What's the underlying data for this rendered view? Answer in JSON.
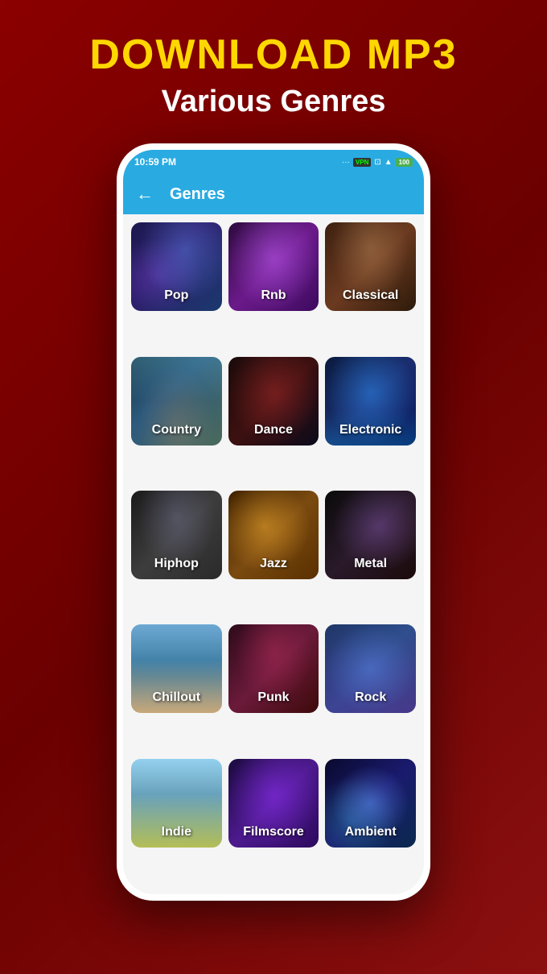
{
  "page": {
    "background": "#8B0000",
    "main_title": "DOWNLOAD MP3",
    "sub_title": "Various Genres"
  },
  "status_bar": {
    "time": "10:59 PM",
    "vpn": "VPN",
    "battery": "100"
  },
  "header": {
    "back_label": "←",
    "title": "Genres"
  },
  "genres": [
    {
      "id": "pop",
      "label": "Pop",
      "class": "genre-pop"
    },
    {
      "id": "rnb",
      "label": "Rnb",
      "class": "genre-rnb"
    },
    {
      "id": "classical",
      "label": "Classical",
      "class": "genre-classical"
    },
    {
      "id": "country",
      "label": "Country",
      "class": "genre-country"
    },
    {
      "id": "dance",
      "label": "Dance",
      "class": "genre-dance"
    },
    {
      "id": "electronic",
      "label": "Electronic",
      "class": "genre-electronic"
    },
    {
      "id": "hiphop",
      "label": "Hiphop",
      "class": "genre-hiphop"
    },
    {
      "id": "jazz",
      "label": "Jazz",
      "class": "genre-jazz"
    },
    {
      "id": "metal",
      "label": "Metal",
      "class": "genre-metal"
    },
    {
      "id": "chillout",
      "label": "Chillout",
      "class": "genre-chillout"
    },
    {
      "id": "punk",
      "label": "Punk",
      "class": "genre-punk"
    },
    {
      "id": "rock",
      "label": "Rock",
      "class": "genre-rock"
    },
    {
      "id": "indie",
      "label": "Indie",
      "class": "genre-indie"
    },
    {
      "id": "filmscore",
      "label": "Filmscore",
      "class": "genre-filmscore"
    },
    {
      "id": "ambient",
      "label": "Ambient",
      "class": "genre-ambient"
    }
  ]
}
